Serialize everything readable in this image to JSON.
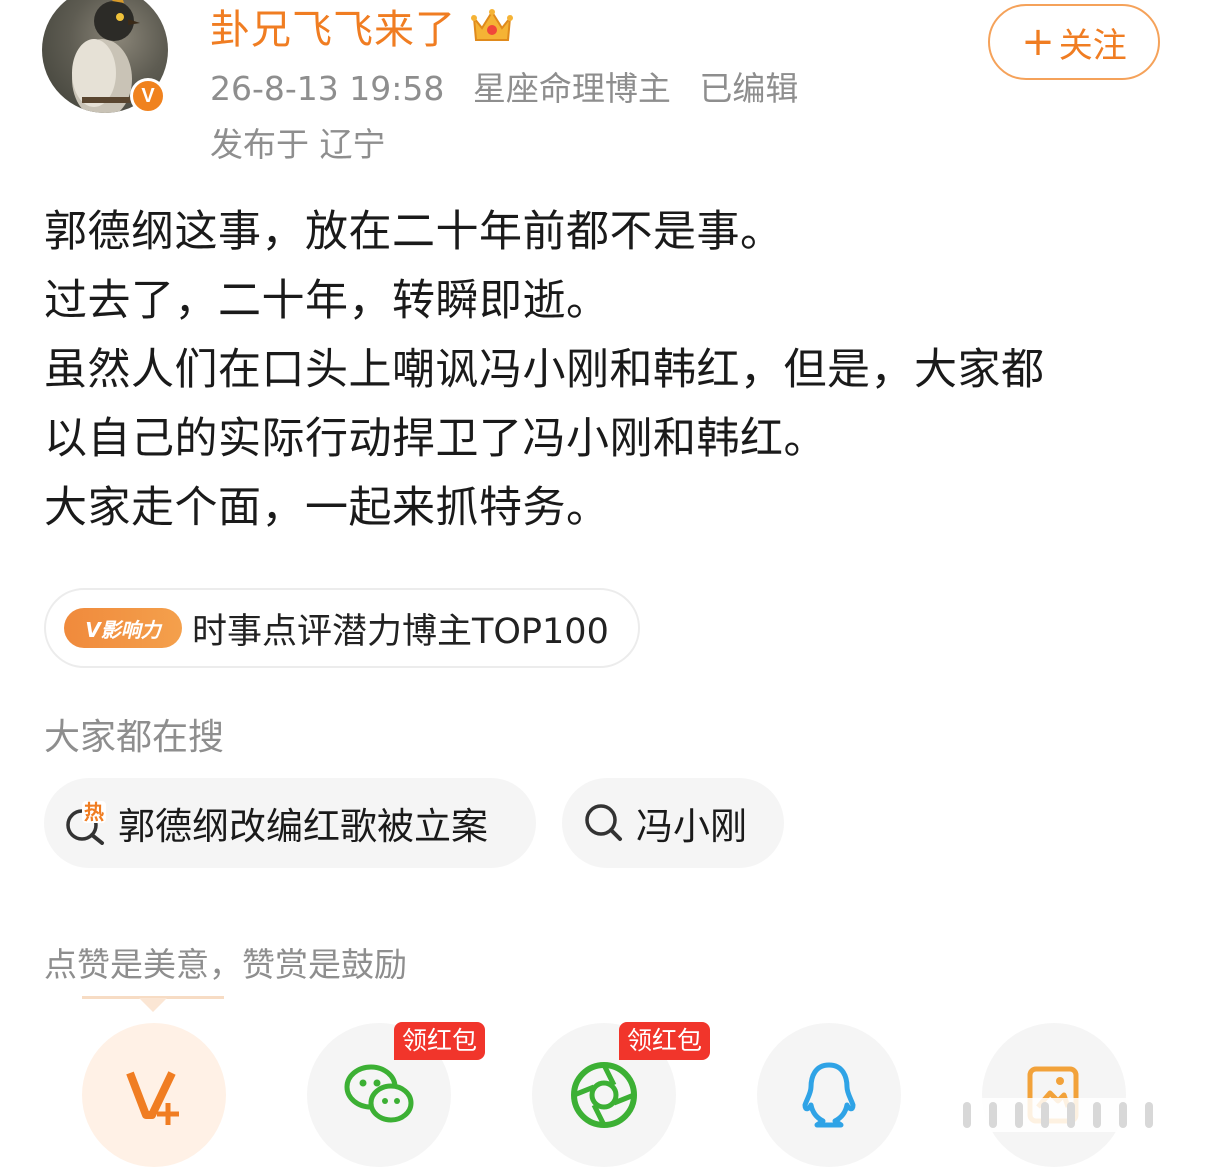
{
  "header": {
    "username": "卦兄飞飞来了",
    "verified_mark": "V",
    "post_time": "26-8-13 19:58",
    "category": "星座命理博主",
    "edited": "已编辑",
    "location": "发布于 辽宁",
    "follow_label": "关注",
    "follow_plus": "+",
    "icons": {
      "crown": "crown-icon",
      "verified": "verified-badge-icon"
    }
  },
  "post": {
    "lines": [
      "郭德纲这事，放在二十年前都不是事。",
      "过去了，二十年，转瞬即逝。",
      "虽然人们在口头上嘲讽冯小刚和韩红，但是，大家都",
      "以自己的实际行动捍卫了冯小刚和韩红。",
      "大家走个面，一起来抓特务。"
    ]
  },
  "influence": {
    "tag_label": "V影响力",
    "text": "时事点评潜力博主TOP100"
  },
  "search": {
    "title": "大家都在搜",
    "items": [
      {
        "label": "郭德纲改编红歌被立案",
        "icon": "hot-search-icon",
        "hot_mark": "热"
      },
      {
        "label": "冯小刚",
        "icon": "search-icon"
      }
    ]
  },
  "reward": {
    "text": "点赞是美意，赞赏是鼓励",
    "share_targets": [
      {
        "icon": "v-plus-icon"
      },
      {
        "icon": "wechat-icon",
        "tag": "领红包"
      },
      {
        "icon": "moments-icon",
        "tag": "领红包"
      },
      {
        "icon": "qq-icon"
      },
      {
        "icon": "gallery-icon"
      }
    ]
  },
  "colors": {
    "accent": "#f07d22",
    "gray_text": "#8e8e8e",
    "red_tag": "#f1352b",
    "wechat_green": "#3cb034",
    "qq_blue": "#2fa3e6"
  }
}
